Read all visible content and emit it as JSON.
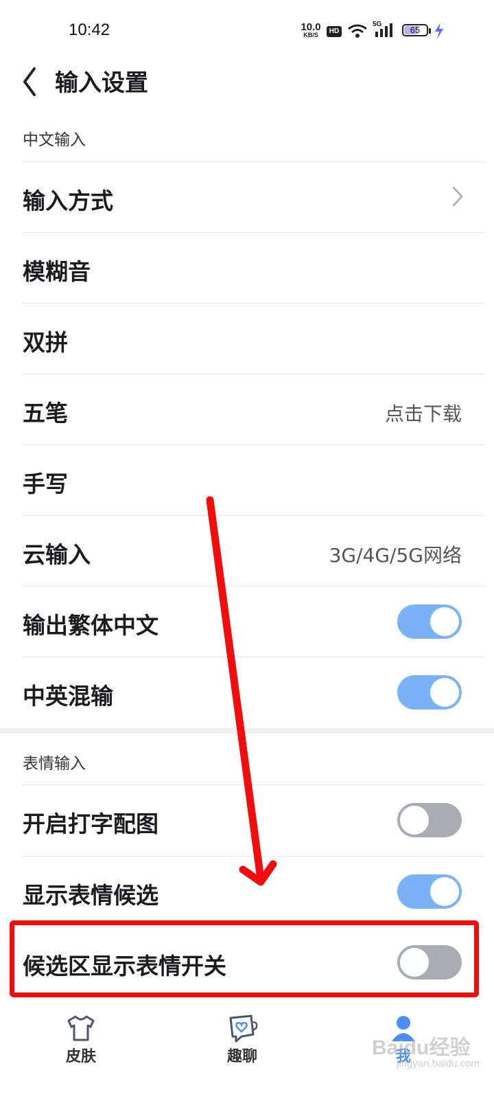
{
  "status_bar": {
    "time": "10:42",
    "net_speed": "10.0",
    "net_speed_unit": "KB/S",
    "hd": "HD",
    "network_type": "5G",
    "battery": "65",
    "battery_level_percent": 65,
    "icons": [
      "wifi-icon",
      "cell-signal-icon",
      "battery-icon",
      "charging-bolt-icon"
    ]
  },
  "header": {
    "title": "输入设置",
    "back_icon": "chevron-left-icon"
  },
  "sections": [
    {
      "label": "中文输入",
      "items": [
        {
          "label": "输入方式",
          "control": "chevron"
        },
        {
          "label": "模糊音"
        },
        {
          "label": "双拼"
        },
        {
          "label": "五笔",
          "value": "点击下载"
        },
        {
          "label": "手写"
        },
        {
          "label": "云输入",
          "value": "3G/4G/5G网络"
        },
        {
          "label": "输出繁体中文",
          "control": "toggle",
          "on": true
        },
        {
          "label": "中英混输",
          "control": "toggle",
          "on": true
        }
      ]
    },
    {
      "label": "表情输入",
      "items": [
        {
          "label": "开启打字配图",
          "control": "toggle",
          "on": false
        },
        {
          "label": "显示表情候选",
          "control": "toggle",
          "on": true
        },
        {
          "label": "候选区显示表情开关",
          "control": "toggle",
          "on": false
        }
      ]
    }
  ],
  "tabbar": {
    "tabs": [
      {
        "label": "皮肤",
        "icon": "tshirt-icon"
      },
      {
        "label": "趣聊",
        "icon": "chat-heart-icon"
      },
      {
        "label": "我",
        "icon": "user-icon",
        "active": true
      }
    ]
  },
  "annotations": {
    "arrow_color": "#f20d0d",
    "highlight_color": "#f20d0d"
  },
  "watermark": {
    "text": "Baidu经验",
    "sub": "jingyan.baidu.com"
  },
  "colors": {
    "toggle_on": "#7ab2f7",
    "toggle_off": "#a9adb3",
    "accent": "#4a8ef2"
  }
}
